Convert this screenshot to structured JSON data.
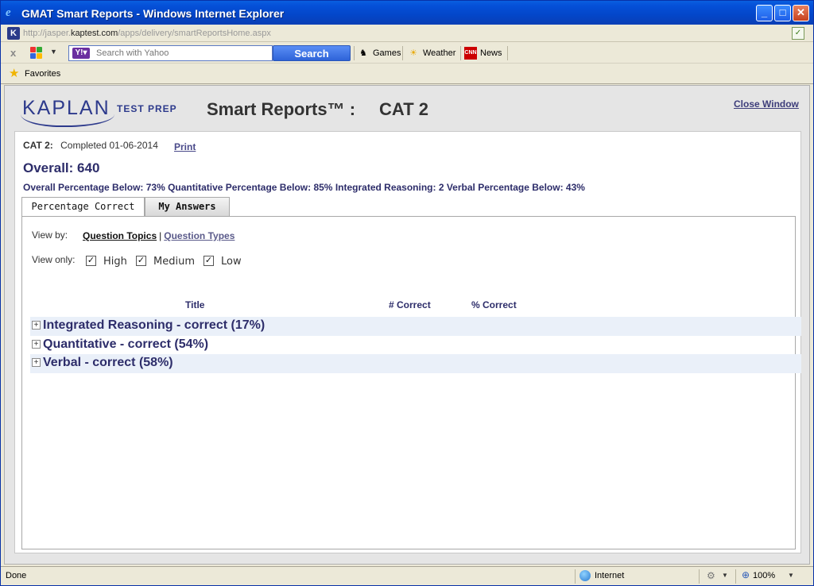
{
  "window": {
    "title": "GMAT Smart Reports - Windows Internet Explorer",
    "minimize_glyph": "_",
    "maximize_glyph": "□",
    "close_glyph": "✕"
  },
  "address": {
    "url_prefix": "http://jasper.",
    "url_domain": "kaptest.com",
    "url_suffix": "/apps/delivery/smartReportsHome.aspx"
  },
  "toolbar": {
    "stop_glyph": "x",
    "search_placeholder": "Search with Yahoo",
    "search_button": "Search",
    "items": [
      {
        "label": "Games",
        "icon": "games-icon"
      },
      {
        "label": "Weather",
        "icon": "weather-icon"
      },
      {
        "label": "News",
        "icon": "cnn-icon",
        "icon_text": "CNN"
      }
    ]
  },
  "favorites": {
    "label": "Favorites"
  },
  "page": {
    "logo_word": "KAPLAN",
    "logo_sub": "TEST PREP",
    "title": "Smart Reports™ :",
    "title_cat": "CAT 2",
    "close_window": "Close Window",
    "cat_label": "CAT 2:",
    "completed": "Completed 01-06-2014",
    "print": "Print",
    "overall": "Overall: 640",
    "percentages": "Overall Percentage Below: 73% Quantitative Percentage Below: 85% Integrated Reasoning: 2 Verbal Percentage Below: 43%",
    "tabs": [
      "Percentage Correct",
      "My Answers"
    ],
    "view_by_label": "View by:",
    "view_by_topics": "Question Topics",
    "view_by_separator": "|",
    "view_by_types": "Question Types",
    "view_only_label": "View only:",
    "filters": [
      {
        "label": "High",
        "checked": true
      },
      {
        "label": "Medium",
        "checked": true
      },
      {
        "label": "Low",
        "checked": true
      }
    ],
    "columns": [
      "Title",
      "# Correct",
      "% Correct"
    ],
    "rows": [
      {
        "text": "Integrated Reasoning -  correct (17%)"
      },
      {
        "text": "Quantitative -  correct (54%)"
      },
      {
        "text": "Verbal -  correct (58%)"
      }
    ],
    "expander_glyph": "+"
  },
  "status": {
    "text": "Done",
    "zone": "Internet",
    "zoom": "100%"
  }
}
